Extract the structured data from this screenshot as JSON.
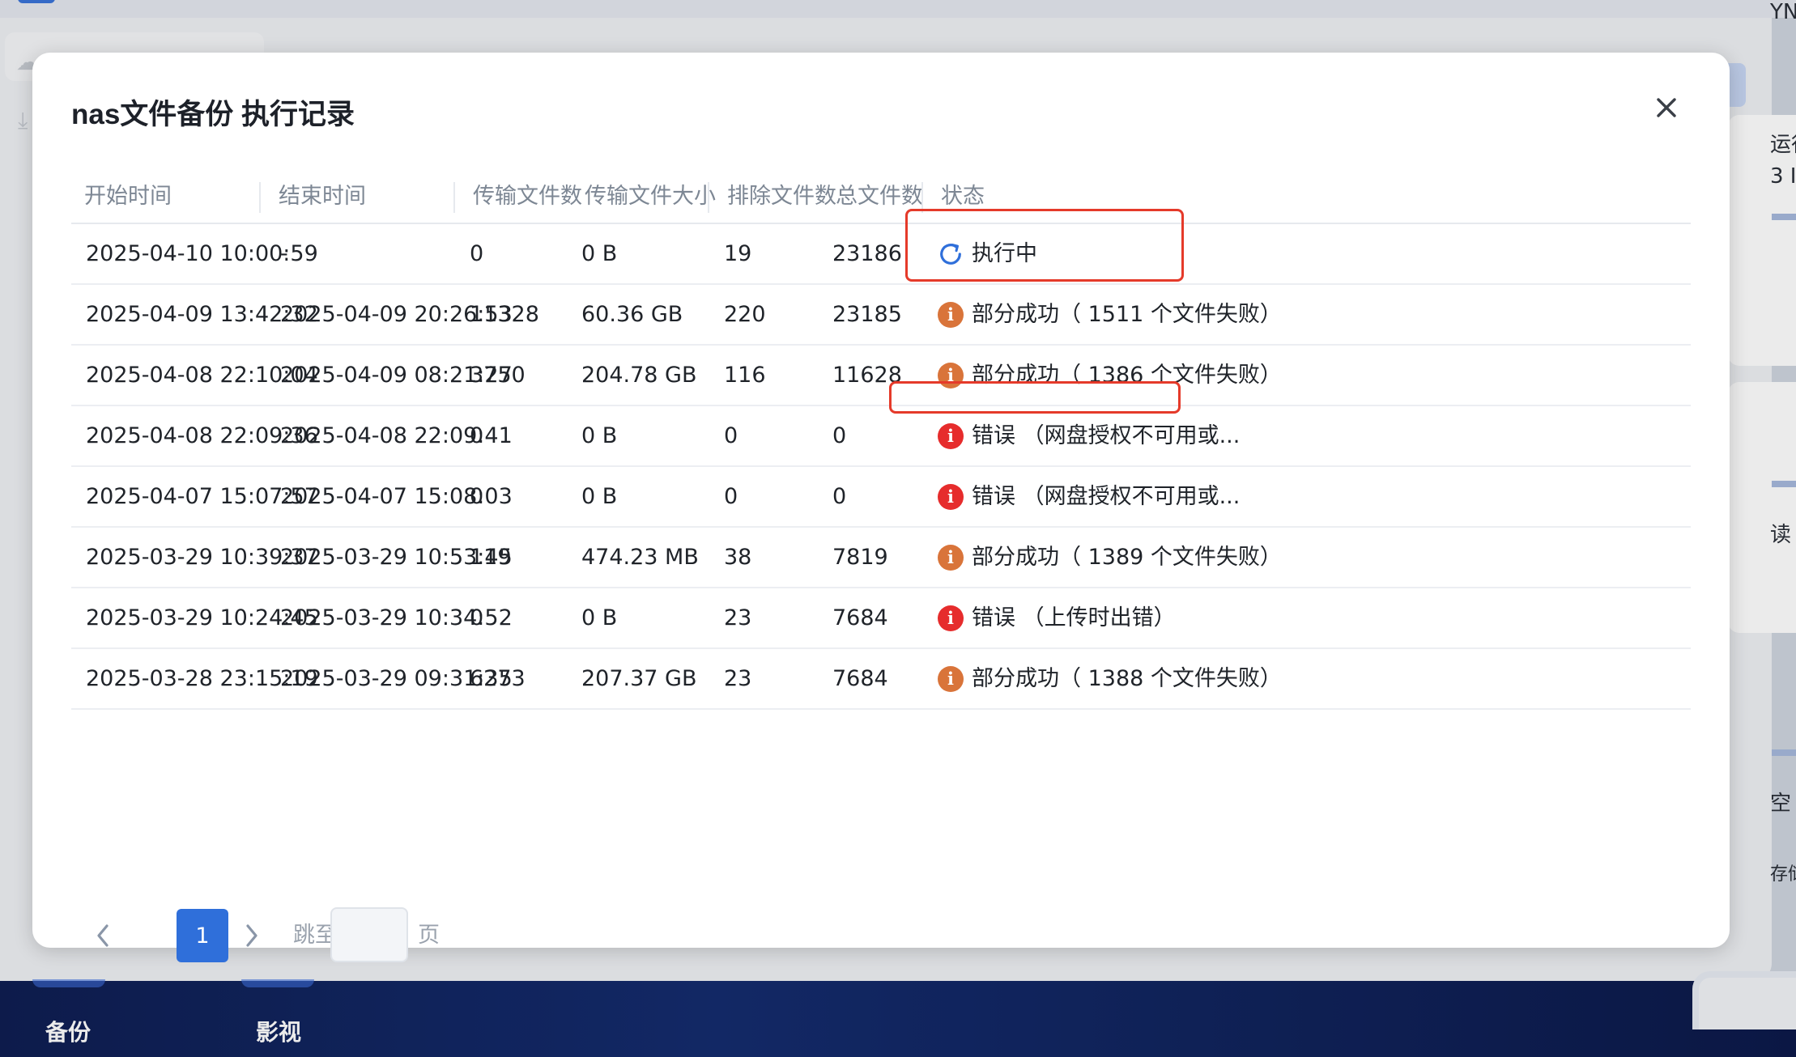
{
  "background": {
    "dock": {
      "items": [
        {
          "label": "备份"
        },
        {
          "label": "影视"
        }
      ]
    },
    "right_edge": {
      "lines": [
        "运行",
        "3 I",
        "YN",
        "读",
        "空",
        "存储"
      ]
    }
  },
  "modal": {
    "title": "nas文件备份 执行记录",
    "close_label": "关闭"
  },
  "table": {
    "columns": [
      "开始时间",
      "结束时间",
      "传输文件数",
      "传输文件大小",
      "排除文件数",
      "总文件数",
      "状态"
    ],
    "rows": [
      {
        "start": "2025-04-10 10:00:59",
        "end": "-",
        "files": "0",
        "size": "0 B",
        "excluded": "19",
        "total": "23186",
        "status_type": "running",
        "status": "执行中"
      },
      {
        "start": "2025-04-09 13:42:32",
        "end": "2025-04-09 20:26:53",
        "files": "11328",
        "size": "60.36 GB",
        "excluded": "220",
        "total": "23185",
        "status_type": "partial",
        "status": "部分成功（ 1511 个文件失败）"
      },
      {
        "start": "2025-04-08 22:10:04",
        "end": "2025-04-09 08:21:27",
        "files": "3750",
        "size": "204.78 GB",
        "excluded": "116",
        "total": "11628",
        "status_type": "partial",
        "status": "部分成功（ 1386 个文件失败）"
      },
      {
        "start": "2025-04-08 22:09:36",
        "end": "2025-04-08 22:09:41",
        "files": "0",
        "size": "0 B",
        "excluded": "0",
        "total": "0",
        "status_type": "error",
        "status": "错误 （网盘授权不可用或..."
      },
      {
        "start": "2025-04-07 15:07:57",
        "end": "2025-04-07 15:08:03",
        "files": "0",
        "size": "0 B",
        "excluded": "0",
        "total": "0",
        "status_type": "error",
        "status": "错误 （网盘授权不可用或..."
      },
      {
        "start": "2025-03-29 10:39:37",
        "end": "2025-03-29 10:53:45",
        "files": "119",
        "size": "474.23 MB",
        "excluded": "38",
        "total": "7819",
        "status_type": "partial",
        "status": "部分成功（ 1389 个文件失败）"
      },
      {
        "start": "2025-03-29 10:24:45",
        "end": "2025-03-29 10:34:52",
        "files": "0",
        "size": "0 B",
        "excluded": "23",
        "total": "7684",
        "status_type": "error",
        "status": "错误 （上传时出错）"
      },
      {
        "start": "2025-03-28 23:15:19",
        "end": "2025-03-29 09:31:35",
        "files": "6273",
        "size": "207.37 GB",
        "excluded": "23",
        "total": "7684",
        "status_type": "partial",
        "status": "部分成功（ 1388 个文件失败）"
      }
    ]
  },
  "pagination": {
    "current_page": "1",
    "goto_label": "跳至",
    "goto_value": "",
    "page_unit": "页"
  },
  "colors": {
    "accent": "#2f6fda",
    "warning": "#d9743a",
    "error": "#e62c2c",
    "running": "#2f6fda",
    "highlight_box": "#e53a2a"
  },
  "icons": {
    "running": "refresh-icon",
    "partial": "info-icon",
    "error": "error-icon",
    "close": "close-icon"
  }
}
